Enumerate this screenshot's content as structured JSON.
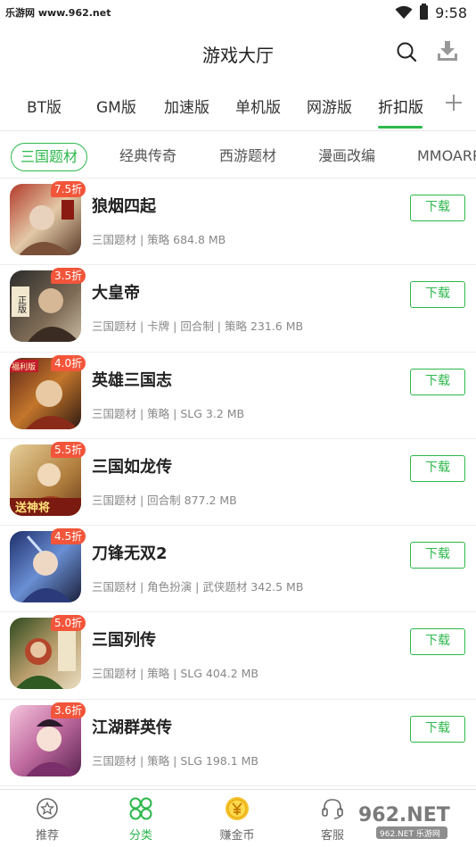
{
  "status": {
    "watermark": "乐游网 www.962.net",
    "time": "9:58"
  },
  "header": {
    "title": "游戏大厅",
    "search_icon": "search-icon",
    "download_icon": "download-manager-icon"
  },
  "category_tabs": [
    {
      "label": "BT版"
    },
    {
      "label": "GM版"
    },
    {
      "label": "加速版"
    },
    {
      "label": "单机版"
    },
    {
      "label": "网游版"
    },
    {
      "label": "折扣版",
      "active": true
    }
  ],
  "sub_tabs": [
    {
      "label": "三国题材",
      "active": true
    },
    {
      "label": "经典传奇"
    },
    {
      "label": "西游题材"
    },
    {
      "label": "漫画改编"
    },
    {
      "label": "MMOARPG"
    }
  ],
  "download_label": "下载",
  "games": [
    {
      "name": "狼烟四起",
      "discount": "7.5折",
      "meta": "三国题材 | 策略 684.8 MB"
    },
    {
      "name": "大皇帝",
      "discount": "3.5折",
      "meta": "三国题材 | 卡牌 | 回合制 | 策略 231.6 MB"
    },
    {
      "name": "英雄三国志",
      "discount": "4.0折",
      "meta": "三国题材 | 策略 | SLG 3.2 MB"
    },
    {
      "name": "三国如龙传",
      "discount": "5.5折",
      "meta": "三国题材 | 回合制 877.2 MB"
    },
    {
      "name": "刀锋无双2",
      "discount": "4.5折",
      "meta": "三国题材 | 角色扮演 | 武侠题材 342.5 MB"
    },
    {
      "name": "三国列传",
      "discount": "5.0折",
      "meta": "三国题材 | 策略 | SLG 404.2 MB"
    },
    {
      "name": "江湖群英传",
      "discount": "3.6折",
      "meta": "三国题材 | 策略 | SLG 198.1 MB"
    }
  ],
  "icon_labels": {
    "row2": "正版",
    "row3": "福利版",
    "row4": "送神将"
  },
  "bottom_nav": [
    {
      "label": "推荐",
      "icon": "star-circle-icon"
    },
    {
      "label": "分类",
      "icon": "category-grid-icon",
      "active": true
    },
    {
      "label": "赚金币",
      "icon": "coin-icon"
    },
    {
      "label": "客服",
      "icon": "headset-icon"
    }
  ],
  "logo_watermark": "962.NET 乐游网",
  "colors": {
    "accent": "#2db84b",
    "discount": "#f2553a"
  }
}
